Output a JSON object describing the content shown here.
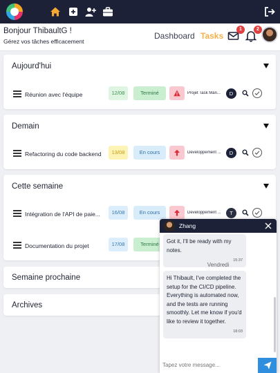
{
  "colors": {
    "topbar": "#1c2137",
    "accent": "#f6b04a",
    "status_done": "#c9efd0",
    "status_progress": "#d9ecfa",
    "priority_high": "#f9c9cf",
    "date_done": "#def5e1",
    "date_warning": "#fdf3b5",
    "date_default": "#dceefb",
    "send_button": "#2f8fde"
  },
  "topbar": {
    "icons": [
      "app-logo",
      "home-icon",
      "add-icon",
      "add-user-icon",
      "briefcase-icon",
      "logout-icon"
    ]
  },
  "header": {
    "greeting": "Bonjour ThibaultG !",
    "subtitle": "Gérez vos tâches efficacement",
    "nav_dashboard": "Dashboard",
    "nav_tasks": "Tasks",
    "messages_badge": "1",
    "notifications_badge": "2"
  },
  "sections": {
    "today": {
      "title": "Aujourd'hui",
      "tasks": [
        {
          "name": "Réunion avec l'équipe",
          "date": "12/08",
          "status": "Terminé",
          "priority_icon": "warning-icon",
          "project": "Projet Task Man...",
          "user": "D"
        }
      ]
    },
    "tomorrow": {
      "title": "Demain",
      "tasks": [
        {
          "name": "Refactoring du code backend",
          "date": "13/08",
          "status": "En cours",
          "priority_icon": "arrow-up-icon",
          "project": "Développement ...",
          "user": "D"
        }
      ]
    },
    "this_week": {
      "title": "Cette semaine",
      "tasks": [
        {
          "name": "Intégration de l'API de paie...",
          "date": "16/08",
          "status": "En cours",
          "priority_icon": "arrow-up-icon",
          "project": "Développement ...",
          "user": "T"
        },
        {
          "name": "Documentation du projet",
          "date": "17/08",
          "status": "Terminé"
        }
      ]
    },
    "next_week": {
      "title": "Semaine prochaine"
    },
    "archives": {
      "title": "Archives"
    }
  },
  "chat": {
    "contact": "Zhang",
    "messages": [
      {
        "text": "Got it, I'll be ready with my notes.",
        "time": "15:37"
      },
      {
        "text": "Hi Thibault, I've completed the setup for the CI/CD pipeline. Everything is automated now, and the tests are running smoothly. Let me know if you'd like to review it together.",
        "time": "18:03"
      }
    ],
    "day_separator": "Vendredi",
    "input_placeholder": "Tapez votre message..."
  }
}
